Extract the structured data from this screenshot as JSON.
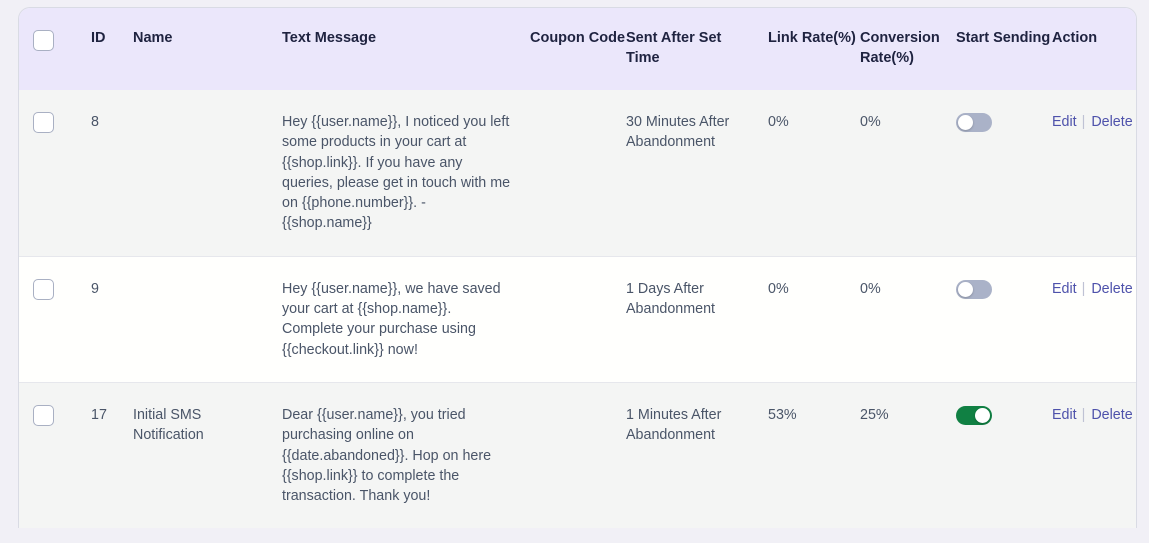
{
  "table": {
    "headers": {
      "select_all": "",
      "id": "ID",
      "name": "Name",
      "text_message": "Text Message",
      "coupon_code": "Coupon Code",
      "sent_after_set_time": "Sent After Set Time",
      "link_rate": "Link Rate(%)",
      "conversion_rate": "Conversion Rate(%)",
      "start_sending": "Start Sending",
      "action": "Action"
    },
    "header_bg": "#ebe7fb",
    "row_shaded_bg": "#f4f5f4",
    "row_plain_bg": "#fffffd",
    "link_color": "#4e52ab",
    "toggle_on_color": "#108043",
    "toggle_off_color": "#aab2c8",
    "action_labels": {
      "edit": "Edit",
      "separator": "|",
      "delete": "Delete"
    },
    "rows": [
      {
        "id": "8",
        "name": "",
        "text_message": "Hey {{user.name}}, I noticed you left some products in your cart at {{shop.link}}. If you have any queries, please get in touch with me on {{phone.number}}. -{{shop.name}}",
        "coupon_code": "",
        "sent_after_set_time": "30 Minutes After Abandonment",
        "link_rate": "0%",
        "conversion_rate": "0%",
        "start_sending": "off",
        "checked": false
      },
      {
        "id": "9",
        "name": "",
        "text_message": "Hey {{user.name}}, we have saved your cart at {{shop.name}}. Complete your purchase using {{checkout.link}} now!",
        "coupon_code": "",
        "sent_after_set_time": "1 Days After Abandonment",
        "link_rate": "0%",
        "conversion_rate": "0%",
        "start_sending": "off",
        "checked": false
      },
      {
        "id": "17",
        "name": "Initial SMS Notification",
        "text_message": "Dear {{user.name}}, you tried purchasing online on {{date.abandoned}}. Hop on here {{shop.link}} to complete the transaction. Thank you!",
        "coupon_code": "",
        "sent_after_set_time": "1 Minutes After Abandonment",
        "link_rate": "53%",
        "conversion_rate": "25%",
        "start_sending": "on",
        "checked": false
      }
    ]
  }
}
